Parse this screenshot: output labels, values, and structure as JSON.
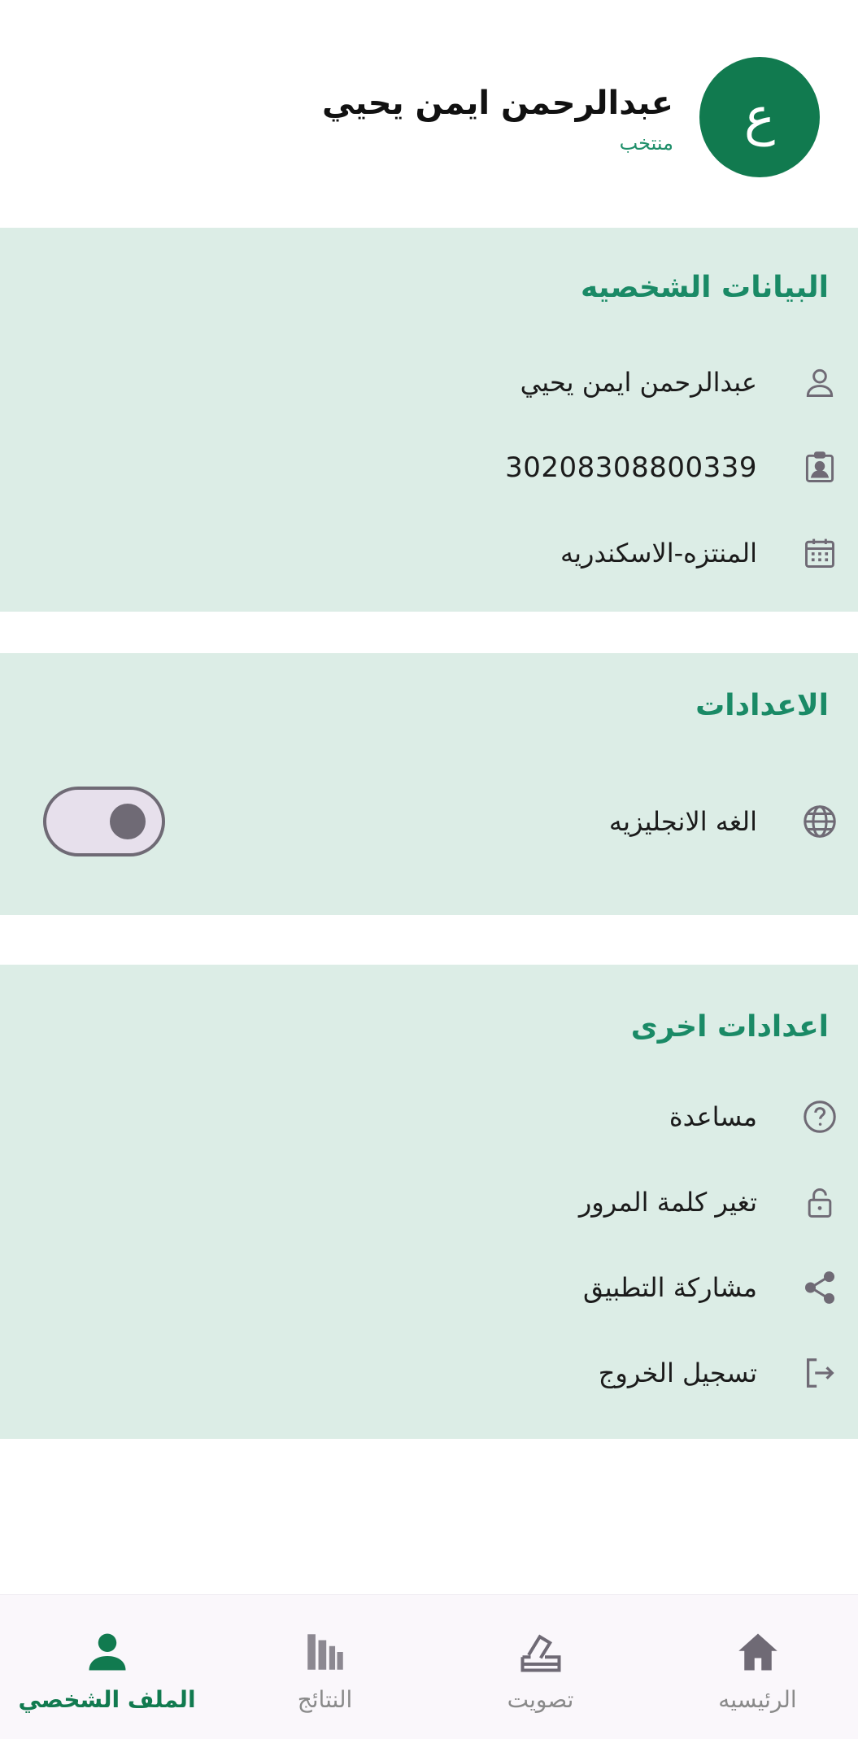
{
  "header": {
    "avatar_letter": "ع",
    "name": "عبدالرحمن ايمن يحيي",
    "role": "منتخب"
  },
  "personal": {
    "title": "البيانات الشخصيه",
    "rows": [
      {
        "icon": "person-icon",
        "label": "عبدالرحمن ايمن يحيي"
      },
      {
        "icon": "id-card-icon",
        "label": "30208308800339"
      },
      {
        "icon": "calendar-icon",
        "label": "المنتزه-الاسكندريه"
      }
    ]
  },
  "settings": {
    "title": "الاعدادات",
    "language_label": "الغه الانجليزيه",
    "language_icon": "globe-icon",
    "language_toggle_on": false
  },
  "other": {
    "title": "اعدادات اخرى",
    "rows": [
      {
        "icon": "help-icon",
        "label": "مساعدة"
      },
      {
        "icon": "lock-icon",
        "label": "تغير كلمة المرور"
      },
      {
        "icon": "share-icon",
        "label": "مشاركة التطبيق"
      },
      {
        "icon": "logout-icon",
        "label": "تسجيل الخروج"
      }
    ]
  },
  "bottom_nav": {
    "items": [
      {
        "icon": "home-icon",
        "label": "الرئيسيه",
        "active": false
      },
      {
        "icon": "ballot-icon",
        "label": "تصويت",
        "active": false
      },
      {
        "icon": "bar-chart-icon",
        "label": "النتائج",
        "active": false
      },
      {
        "icon": "person-icon",
        "label": "الملف الشخصي",
        "active": true
      }
    ]
  },
  "colors": {
    "accent": "#117a4f",
    "section_bg": "#dcede6",
    "title_green": "#1a8a66",
    "icon_gray": "#6f6a75"
  }
}
